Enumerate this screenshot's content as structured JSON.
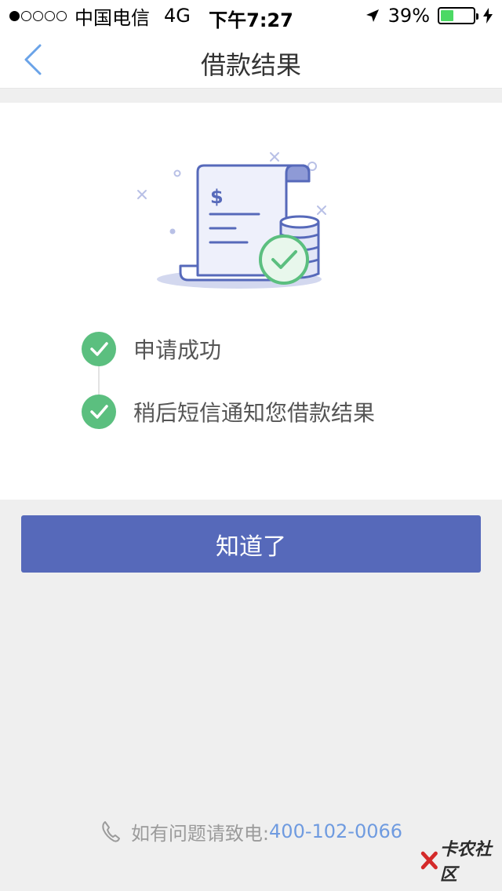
{
  "status_bar": {
    "carrier": "中国电信",
    "network": "4G",
    "time": "下午7:27",
    "battery": "39%",
    "battery_level": 0.39
  },
  "nav": {
    "title": "借款结果"
  },
  "illustration": {
    "currency_symbol": "$"
  },
  "steps": [
    {
      "label": "申请成功"
    },
    {
      "label": "稍后短信通知您借款结果"
    }
  ],
  "actions": {
    "ok_label": "知道了"
  },
  "footer": {
    "hotline_prefix": "如有问题请致电:",
    "hotline_number": "400-102-0066"
  },
  "watermark": {
    "text": "卡农社区"
  },
  "colors": {
    "accent": "#5669ba",
    "success": "#5bbf7f",
    "link": "#6f9be0",
    "back": "#6aa3e8"
  }
}
